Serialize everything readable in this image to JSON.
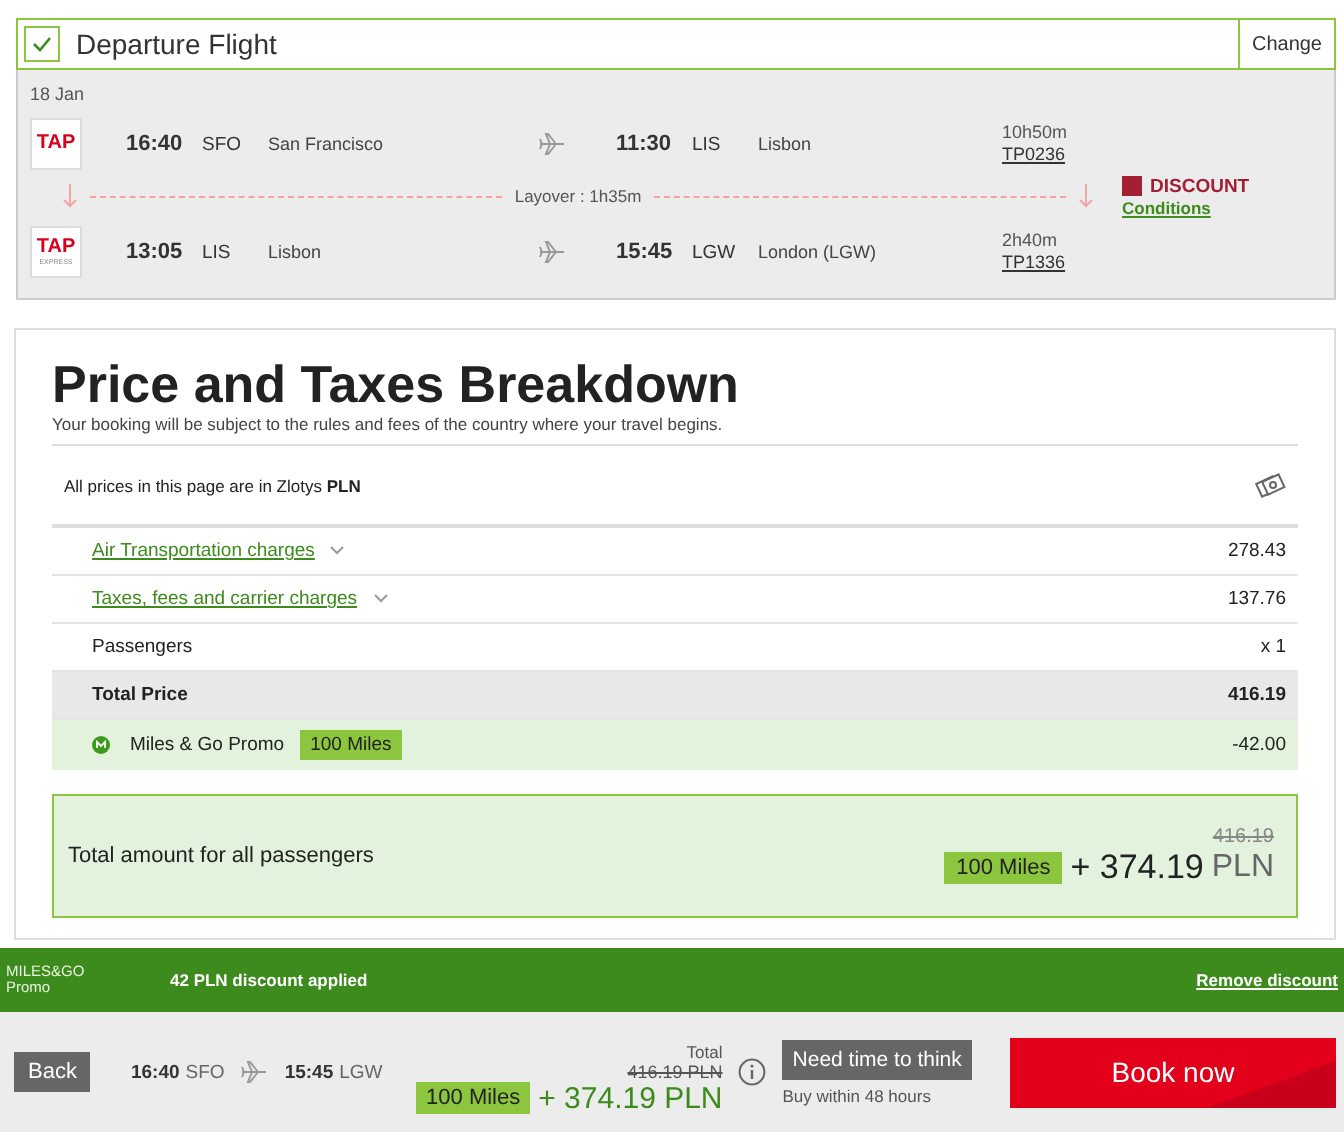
{
  "flight": {
    "title": "Departure Flight",
    "confirmed": true,
    "change": "Change",
    "date": "18 Jan",
    "segments": [
      {
        "logo": "TAP",
        "dep_time": "16:40",
        "dep_code": "SFO",
        "dep_city": "San Francisco",
        "arr_time": "11:30",
        "arr_code": "LIS",
        "arr_city": "Lisbon",
        "duration": "10h50m",
        "flight_no": "TP0236"
      },
      {
        "logo": "TAP",
        "logo_sub": "EXPRESS",
        "dep_time": "13:05",
        "dep_code": "LIS",
        "dep_city": "Lisbon",
        "arr_time": "15:45",
        "arr_code": "LGW",
        "arr_city": "London (LGW)",
        "duration": "2h40m",
        "flight_no": "TP1336"
      }
    ],
    "layover": "Layover : 1h35m",
    "fare": "DISCOUNT",
    "conditions": "Conditions"
  },
  "breakdown": {
    "title": "Price and Taxes Breakdown",
    "subtitle": "Your booking will be subject to the rules and fees of the country where your travel begins.",
    "currency_note": "All prices in this page are in Zlotys **PLN**",
    "rows": [
      {
        "kind": "link",
        "label": "Air Transportation charges",
        "expanded": false,
        "value": "278.43"
      },
      {
        "kind": "link",
        "label": "Taxes, fees and carrier charges",
        "expanded": false,
        "value": "137.76"
      },
      {
        "kind": "plain",
        "label": "Passengers",
        "value": "x 1"
      },
      {
        "kind": "total",
        "label": "Total Price",
        "value": "416.19"
      },
      {
        "kind": "promo",
        "label": "Miles & Go Promo",
        "badge": "100 Miles",
        "value": "-42.00"
      }
    ],
    "total": {
      "label": "Total amount for all passengers",
      "old_price": "416.19",
      "badge": "100 Miles",
      "price": "+ 374.19",
      "currency": "PLN"
    }
  },
  "promo_bar": {
    "logo": "MILES&GO",
    "logo_sub": "Promo",
    "message": "42 PLN discount applied",
    "action": "Remove discount"
  },
  "footer": {
    "back": "Back",
    "dep_time": "16:40",
    "dep_code": "SFO",
    "arr_time": "15:45",
    "arr_code": "LGW",
    "total_label": "Total",
    "old_price": "416.19 PLN",
    "badge": "100 Miles",
    "price": "+ 374.19 PLN",
    "hold": "Need time to think",
    "hold_note": "Buy within 48 hours",
    "book": "Book now"
  }
}
